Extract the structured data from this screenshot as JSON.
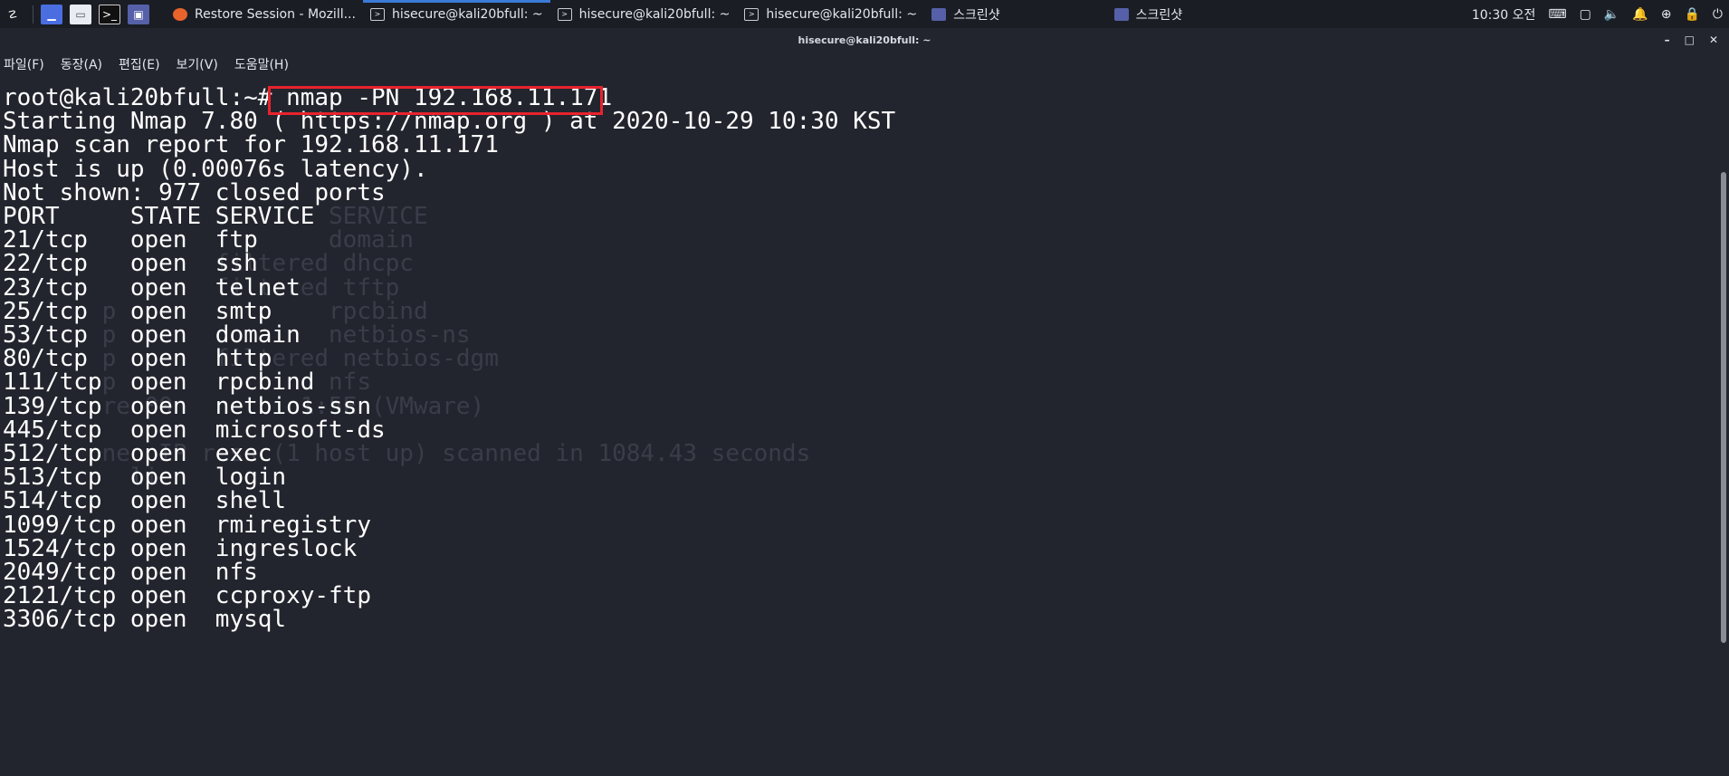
{
  "panel": {
    "tasks": [
      {
        "label": "Restore Session - Mozill..."
      },
      {
        "label": "hisecure@kali20bfull: ~"
      },
      {
        "label": "hisecure@kali20bfull: ~"
      },
      {
        "label": "hisecure@kali20bfull: ~"
      },
      {
        "label": "스크린샷"
      },
      {
        "label": "스크린샷"
      }
    ],
    "clock": "10:30 오전"
  },
  "window": {
    "title": "hisecure@kali20bfull: ~"
  },
  "menu": [
    "파일(F)",
    "동장(A)",
    "편집(E)",
    "보기(V)",
    "도움말(H)"
  ],
  "terminal": {
    "prompt": "root@kali20bfull:~#",
    "command": "nmap -PN 192.168.11.171",
    "lines": [
      "Starting Nmap 7.80 ( https://nmap.org ) at 2020-10-29 10:30 KST",
      "Nmap scan report for 192.168.11.171",
      "Host is up (0.00076s latency).",
      "Not shown: 977 closed ports",
      "PORT     STATE SERVICE",
      "21/tcp   open  ftp",
      "22/tcp   open  ssh",
      "23/tcp   open  telnet",
      "25/tcp   open  smtp",
      "53/tcp   open  domain",
      "80/tcp   open  http",
      "111/tcp  open  rpcbind",
      "139/tcp  open  netbios-ssn",
      "445/tcp  open  microsoft-ds",
      "512/tcp  open  exec",
      "513/tcp  open  login",
      "514/tcp  open  shell",
      "1099/tcp open  rmiregistry",
      "1524/tcp open  ingreslock",
      "2049/tcp open  nfs",
      "2121/tcp open  ccproxy-ftp",
      "3306/tcp open  mysql"
    ],
    "ghost_lines": [
      {
        "row": 5,
        "text": "                       SERVICE"
      },
      {
        "row": 6,
        "text": "                       domain"
      },
      {
        "row": 7,
        "text": "               filtered dhcpc"
      },
      {
        "row": 8,
        "text": "               filtered tftp"
      },
      {
        "row": 9,
        "text": "       p               rpcbind"
      },
      {
        "row": 10,
        "text": "       p               netbios-ns"
      },
      {
        "row": 11,
        "text": "       p       filtered netbios-dgm"
      },
      {
        "row": 12,
        "text": "       p               nfs"
      },
      {
        "row": 13,
        "text": "       re 00         1:5E (VMware)"
      },
      {
        "row": 15,
        "text": "       ne  IP ress (1 host up) scanned in 1084.43 seconds"
      },
      {
        "row": 16,
        "text": "         li"
      }
    ]
  }
}
